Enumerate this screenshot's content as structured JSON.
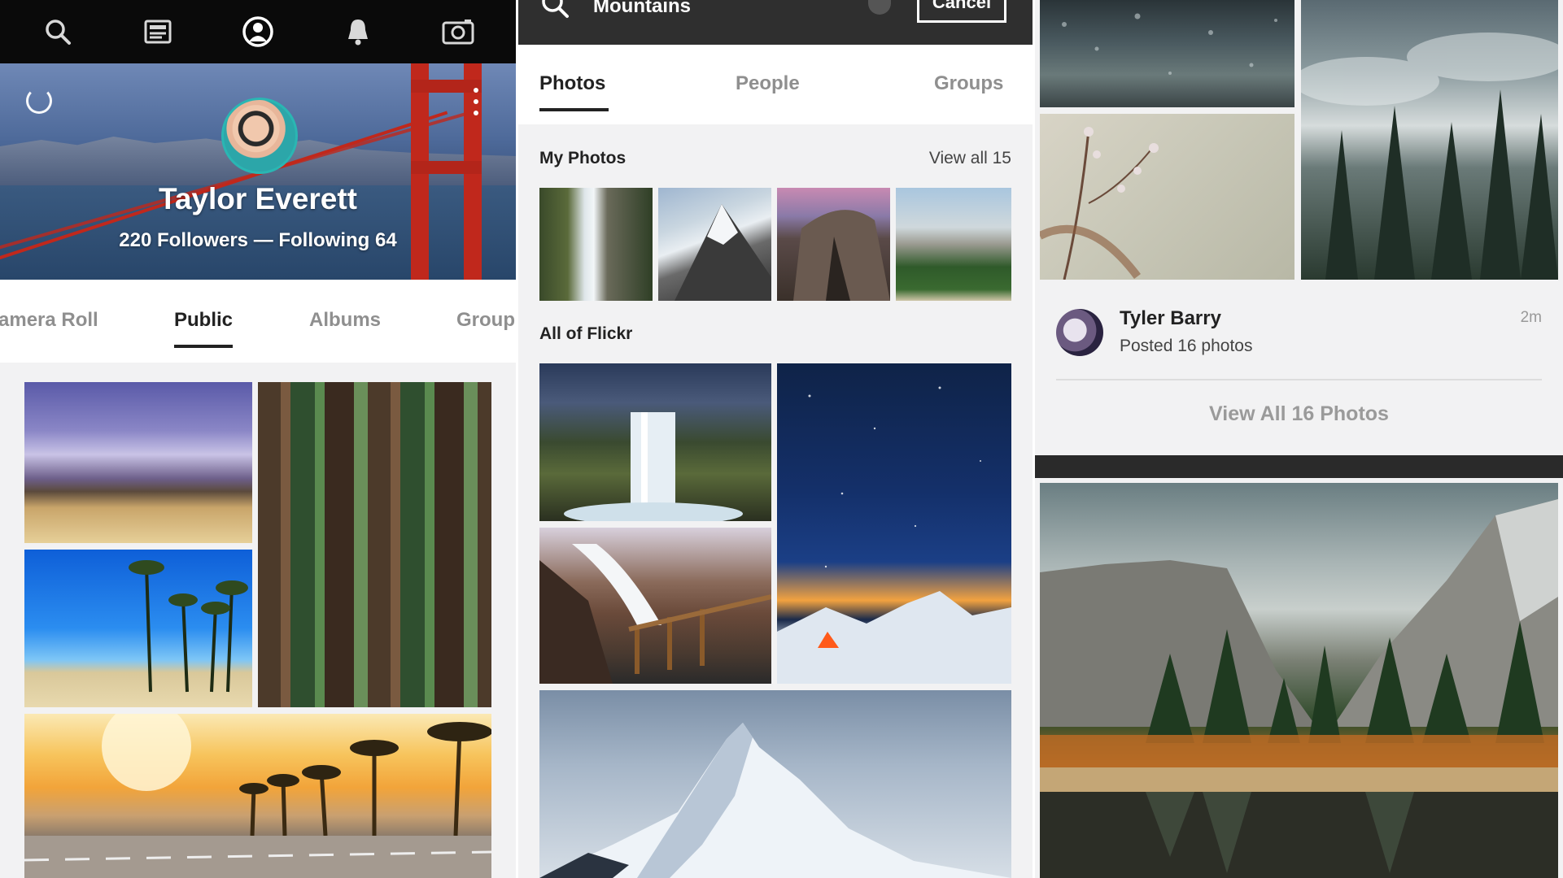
{
  "profile_screen": {
    "top_nav": {
      "icons": [
        "search-icon",
        "feed-icon",
        "profile-icon",
        "notifications-icon",
        "camera-icon"
      ]
    },
    "profile": {
      "name": "Taylor Everett",
      "stats": "220 Followers — Following 64"
    },
    "tabs": [
      {
        "label": "amera Roll",
        "active": false
      },
      {
        "label": "Public",
        "active": true
      },
      {
        "label": "Albums",
        "active": false
      },
      {
        "label": "Group",
        "active": false
      }
    ]
  },
  "search_screen": {
    "search": {
      "query": "Mountains",
      "cancel_label": "Cancel"
    },
    "tabs": [
      {
        "label": "Photos",
        "active": true
      },
      {
        "label": "People",
        "active": false
      },
      {
        "label": "Groups",
        "active": false
      }
    ],
    "my_photos": {
      "title": "My Photos",
      "view_all": "View all 15"
    },
    "all_of_flickr": {
      "title": "All of Flickr"
    }
  },
  "feed_screen": {
    "post": {
      "user_name": "Tyler Barry",
      "activity": "Posted 16 photos",
      "time": "2m",
      "view_all_label": "View All 16 Photos"
    }
  },
  "colors": {
    "top_bar": "#0a0a0a",
    "search_bar": "#2f2f2f",
    "active_tab": "#222222",
    "inactive_tab": "#8f8f8f",
    "panel_bg": "#f2f2f3",
    "avatar_ring": "#2ab6b3"
  }
}
